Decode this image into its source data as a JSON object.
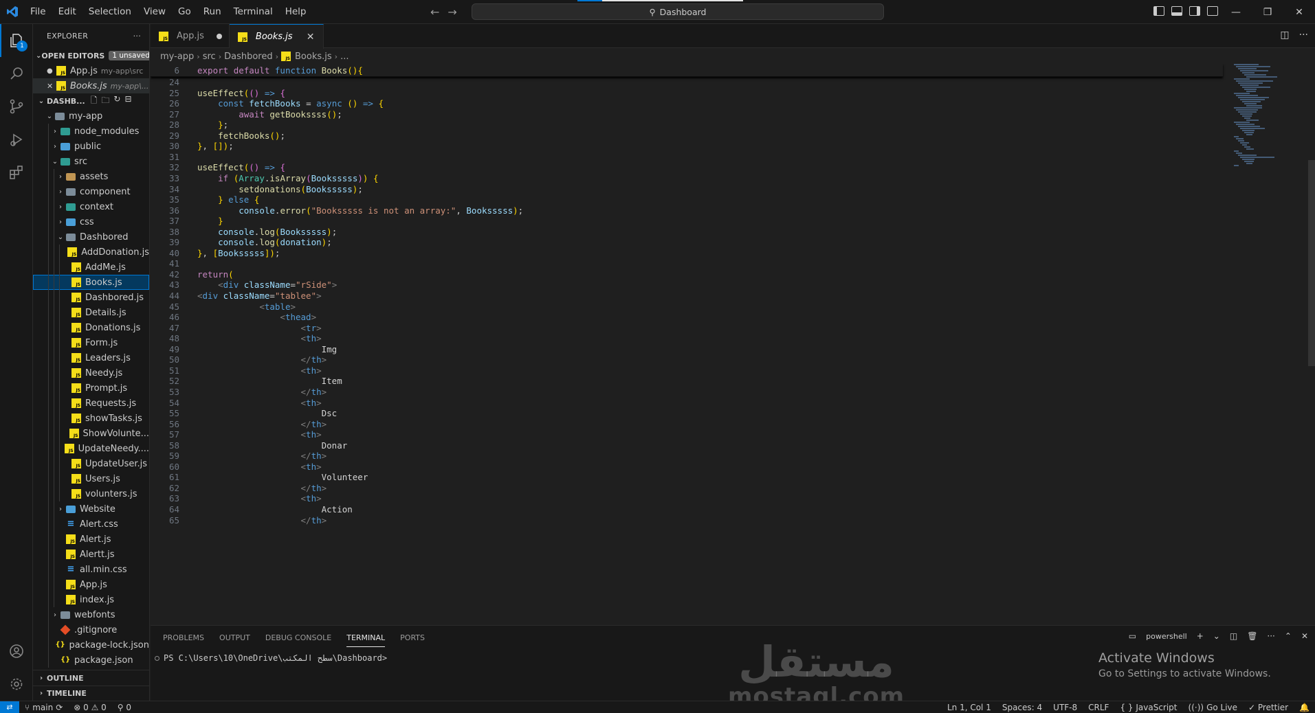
{
  "titlebar": {
    "menu": [
      "File",
      "Edit",
      "Selection",
      "View",
      "Go",
      "Run",
      "Terminal",
      "Help"
    ],
    "search": "Dashboard",
    "window_controls": [
      "minimize-icon",
      "restore-icon",
      "close-icon"
    ]
  },
  "activitybar": {
    "items": [
      "explorer-icon",
      "search-icon",
      "source-control-icon",
      "run-debug-icon",
      "extensions-icon"
    ],
    "explorer_badge": "1",
    "bottom": [
      "account-icon",
      "manage-gear-icon"
    ]
  },
  "sidebar": {
    "title": "EXPLORER",
    "more": "···",
    "open_editors": {
      "label": "OPEN EDITORS",
      "badge": "1 unsaved",
      "files": [
        {
          "name": "App.js",
          "desc": "my-app\\src",
          "unsaved": true
        },
        {
          "name": "Books.js",
          "desc": "my-app\\...",
          "unsaved": false
        }
      ]
    },
    "workspace": {
      "label": "DASHB...",
      "tree": [
        {
          "name": "my-app",
          "type": "folder",
          "depth": 1,
          "open": true,
          "color": "grey"
        },
        {
          "name": "node_modules",
          "type": "folder",
          "depth": 2,
          "open": false,
          "color": "teal"
        },
        {
          "name": "public",
          "type": "folder",
          "depth": 2,
          "open": false,
          "color": "blue"
        },
        {
          "name": "src",
          "type": "folder",
          "depth": 2,
          "open": true,
          "color": "teal"
        },
        {
          "name": "assets",
          "type": "folder",
          "depth": 3,
          "open": false,
          "color": "yellow"
        },
        {
          "name": "component",
          "type": "folder",
          "depth": 3,
          "open": false,
          "color": "grey"
        },
        {
          "name": "context",
          "type": "folder",
          "depth": 3,
          "open": false,
          "color": "teal"
        },
        {
          "name": "css",
          "type": "folder",
          "depth": 3,
          "open": false,
          "color": "blue"
        },
        {
          "name": "Dashbored",
          "type": "folder",
          "depth": 3,
          "open": true,
          "color": "grey"
        },
        {
          "name": "AddDonation.js",
          "type": "js",
          "depth": 4
        },
        {
          "name": "AddMe.js",
          "type": "js",
          "depth": 4
        },
        {
          "name": "Books.js",
          "type": "js",
          "depth": 4,
          "selected": true
        },
        {
          "name": "Dashbored.js",
          "type": "js",
          "depth": 4
        },
        {
          "name": "Details.js",
          "type": "js",
          "depth": 4
        },
        {
          "name": "Donations.js",
          "type": "js",
          "depth": 4
        },
        {
          "name": "Form.js",
          "type": "js",
          "depth": 4
        },
        {
          "name": "Leaders.js",
          "type": "js",
          "depth": 4
        },
        {
          "name": "Needy.js",
          "type": "js",
          "depth": 4
        },
        {
          "name": "Prompt.js",
          "type": "js",
          "depth": 4
        },
        {
          "name": "Requests.js",
          "type": "js",
          "depth": 4
        },
        {
          "name": "showTasks.js",
          "type": "js",
          "depth": 4
        },
        {
          "name": "ShowVolunte...",
          "type": "js",
          "depth": 4
        },
        {
          "name": "UpdateNeedy....",
          "type": "js",
          "depth": 4
        },
        {
          "name": "UpdateUser.js",
          "type": "js",
          "depth": 4
        },
        {
          "name": "Users.js",
          "type": "js",
          "depth": 4
        },
        {
          "name": "volunters.js",
          "type": "js",
          "depth": 4
        },
        {
          "name": "Website",
          "type": "folder",
          "depth": 3,
          "open": false,
          "color": "blue"
        },
        {
          "name": "Alert.css",
          "type": "css",
          "depth": 3
        },
        {
          "name": "Alert.js",
          "type": "js",
          "depth": 3
        },
        {
          "name": "Alertt.js",
          "type": "js",
          "depth": 3
        },
        {
          "name": "all.min.css",
          "type": "css",
          "depth": 3
        },
        {
          "name": "App.js",
          "type": "js",
          "depth": 3
        },
        {
          "name": "index.js",
          "type": "js",
          "depth": 3
        },
        {
          "name": "webfonts",
          "type": "folder",
          "depth": 2,
          "open": false,
          "color": "grey"
        },
        {
          "name": ".gitignore",
          "type": "git",
          "depth": 2
        },
        {
          "name": "package-lock.json",
          "type": "json",
          "depth": 2
        },
        {
          "name": "package.json",
          "type": "json",
          "depth": 2
        }
      ]
    },
    "outline": "OUTLINE",
    "timeline": "TIMELINE"
  },
  "tabs": [
    {
      "name": "App.js",
      "active": false,
      "dirty": true
    },
    {
      "name": "Books.js",
      "active": true,
      "dirty": false
    }
  ],
  "breadcrumb": [
    "my-app",
    "src",
    "Dashbored",
    "Books.js",
    "..."
  ],
  "sticky": {
    "ln": "6",
    "code": "export default function Books(){"
  },
  "code_lines": [
    {
      "ln": "24",
      "code": ""
    },
    {
      "ln": "25",
      "code": "useEffect(() => {"
    },
    {
      "ln": "26",
      "code": "    const fetchBooks = async () => {"
    },
    {
      "ln": "27",
      "code": "        await getBookssss();"
    },
    {
      "ln": "28",
      "code": "    };"
    },
    {
      "ln": "29",
      "code": "    fetchBooks();"
    },
    {
      "ln": "30",
      "code": "}, []);"
    },
    {
      "ln": "31",
      "code": ""
    },
    {
      "ln": "32",
      "code": "useEffect(() => {"
    },
    {
      "ln": "33",
      "code": "    if (Array.isArray(Booksssss)) {"
    },
    {
      "ln": "34",
      "code": "        setdonations(Booksssss);"
    },
    {
      "ln": "35",
      "code": "    } else {"
    },
    {
      "ln": "36",
      "code": "        console.error(\"Booksssss is not an array:\", Booksssss);"
    },
    {
      "ln": "37",
      "code": "    }"
    },
    {
      "ln": "38",
      "code": "    console.log(Booksssss);"
    },
    {
      "ln": "39",
      "code": "    console.log(donation);"
    },
    {
      "ln": "40",
      "code": "}, [Booksssss]);"
    },
    {
      "ln": "41",
      "code": ""
    },
    {
      "ln": "42",
      "code": "return("
    },
    {
      "ln": "43",
      "code": "    <div className=\"rSide\">"
    },
    {
      "ln": "44",
      "code": "<div className=\"tablee\">"
    },
    {
      "ln": "45",
      "code": "            <table>"
    },
    {
      "ln": "46",
      "code": "                <thead>"
    },
    {
      "ln": "47",
      "code": "                    <tr>"
    },
    {
      "ln": "48",
      "code": "                    <th>"
    },
    {
      "ln": "49",
      "code": "                        Img"
    },
    {
      "ln": "50",
      "code": "                    </th>"
    },
    {
      "ln": "51",
      "code": "                    <th>"
    },
    {
      "ln": "52",
      "code": "                        Item"
    },
    {
      "ln": "53",
      "code": "                    </th>"
    },
    {
      "ln": "54",
      "code": "                    <th>"
    },
    {
      "ln": "55",
      "code": "                        Dsc"
    },
    {
      "ln": "56",
      "code": "                    </th>"
    },
    {
      "ln": "57",
      "code": "                    <th>"
    },
    {
      "ln": "58",
      "code": "                        Donar"
    },
    {
      "ln": "59",
      "code": "                    </th>"
    },
    {
      "ln": "60",
      "code": "                    <th>"
    },
    {
      "ln": "61",
      "code": "                        Volunteer"
    },
    {
      "ln": "62",
      "code": "                    </th>"
    },
    {
      "ln": "63",
      "code": "                    <th>"
    },
    {
      "ln": "64",
      "code": "                        Action"
    },
    {
      "ln": "65",
      "code": "                    </th>"
    }
  ],
  "panel": {
    "tabs": [
      "PROBLEMS",
      "OUTPUT",
      "DEBUG CONSOLE",
      "TERMINAL",
      "PORTS"
    ],
    "active_tab": "TERMINAL",
    "shell": "powershell",
    "prompt": "PS C:\\Users\\10\\OneDrive\\سطح المكتب\\Dashboard>",
    "activate_title": "Activate Windows",
    "activate_sub": "Go to Settings to activate Windows.",
    "watermark_ar": "مستقل",
    "watermark_en": "mostaql.com"
  },
  "statusbar": {
    "branch": "main",
    "sync": "⟳",
    "problems": "⊗ 0 ⚠ 0",
    "ports": "⚲ 0",
    "position": "Ln 1, Col 1",
    "spaces": "Spaces: 4",
    "encoding": "UTF-8",
    "eol": "CRLF",
    "language": "{ } JavaScript",
    "golive": "Go Live",
    "prettier": "✓ Prettier",
    "bell": "🔔"
  }
}
